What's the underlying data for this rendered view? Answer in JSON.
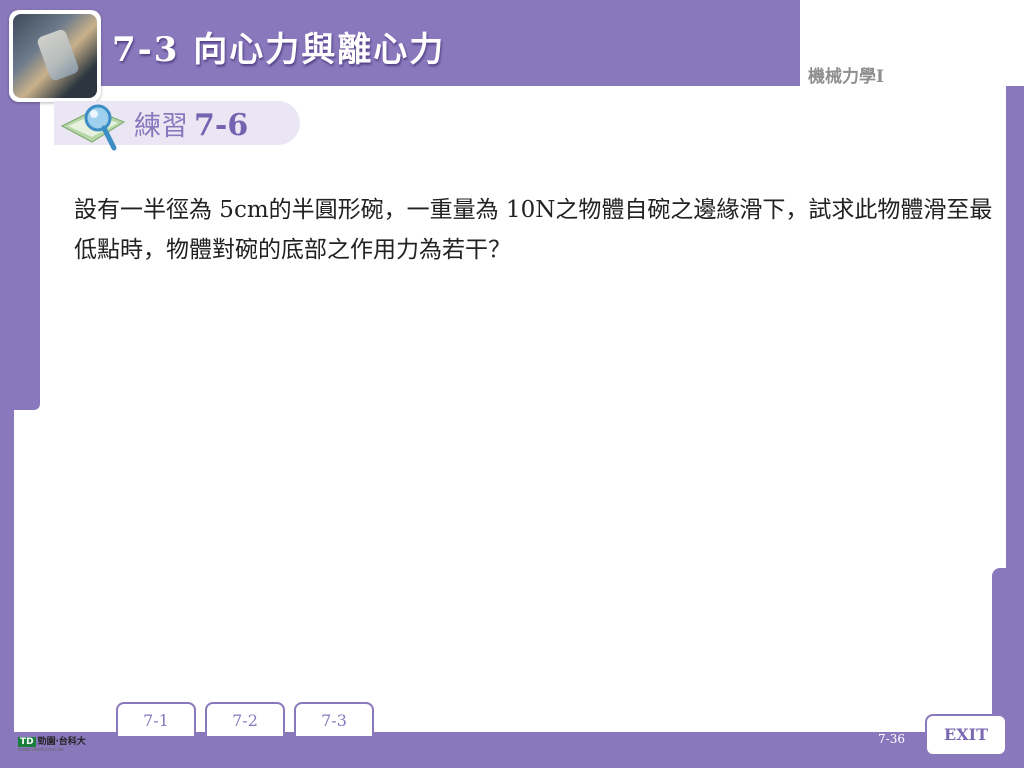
{
  "header": {
    "title": "7-3  向心力與離心力",
    "subject": "機械力學I"
  },
  "practice": {
    "label": "練習",
    "number": "7-6"
  },
  "question": {
    "text": "設有一半徑為 5cm的半圓形碗，一重量為 10N之物體自碗之邊緣滑下，試求此物體滑至最低點時，物體對碗的底部之作用力為若干？"
  },
  "nav": {
    "tabs": [
      {
        "label": "7-1"
      },
      {
        "label": "7-2"
      },
      {
        "label": "7-3"
      }
    ]
  },
  "footer": {
    "logo_mark": "TD",
    "logo_text": "勁園‧台科大",
    "logo_url": "www.tiked.com.tw",
    "page_number": "7-36",
    "exit_label": "EXIT"
  },
  "colors": {
    "theme_purple": "#8a78bd",
    "pill_background": "#ebe6f4"
  }
}
